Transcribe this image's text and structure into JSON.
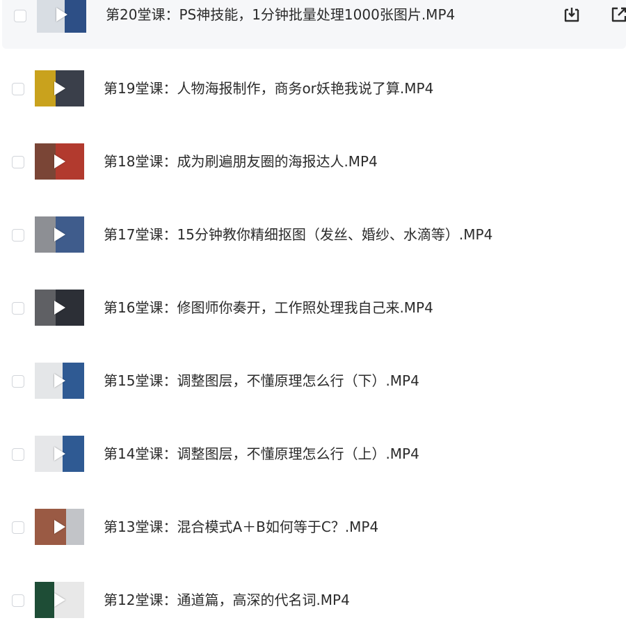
{
  "files": [
    {
      "title": "第20堂课：PS神技能，1分钟批量处理1000张图片.MP4",
      "thumb": [
        "#d8dde3",
        "#2d4f86"
      ],
      "hover": true
    },
    {
      "title": "第19堂课：人物海报制作，商务or妖艳我说了算.MP4",
      "thumb": [
        "#c9a21d",
        "#3a3f4a"
      ],
      "hover": false
    },
    {
      "title": "第18堂课：成为刷遍朋友圈的海报达人.MP4",
      "thumb": [
        "#7a4536",
        "#b23a2e"
      ],
      "hover": false
    },
    {
      "title": "第17堂课：15分钟教你精细抠图（发丝、婚纱、水滴等）.MP4",
      "thumb": [
        "#8d8f94",
        "#3f5c8c"
      ],
      "hover": false
    },
    {
      "title": "第16堂课：修图师你奏开，工作照处理我自己来.MP4",
      "thumb": [
        "#5f6064",
        "#2c2f36"
      ],
      "hover": false
    },
    {
      "title": "第15堂课：调整图层，不懂原理怎么行（下）.MP4",
      "thumb": [
        "#e4e6e8",
        "#2f5a93"
      ],
      "hover": false
    },
    {
      "title": "第14堂课：调整图层，不懂原理怎么行（上）.MP4",
      "thumb": [
        "#e6e7e9",
        "#2f5a93"
      ],
      "hover": false
    },
    {
      "title": "第13堂课：混合模式A＋B如何等于C？.MP4",
      "thumb": [
        "#9a5a44",
        "#c2c4c8"
      ],
      "hover": false
    },
    {
      "title": "第12堂课：通道篇，高深的代名词.MP4",
      "thumb": [
        "#1e4d36",
        "#e8e8e8"
      ],
      "hover": false
    }
  ],
  "actions": {
    "download_icon": "download-icon",
    "share_icon": "share-icon",
    "icon_color": "#2b2b2b"
  },
  "colors": {
    "row_hover_bg": "#f6f7f9",
    "checkbox_border": "#d2d5da",
    "text": "#2b2b2b"
  }
}
